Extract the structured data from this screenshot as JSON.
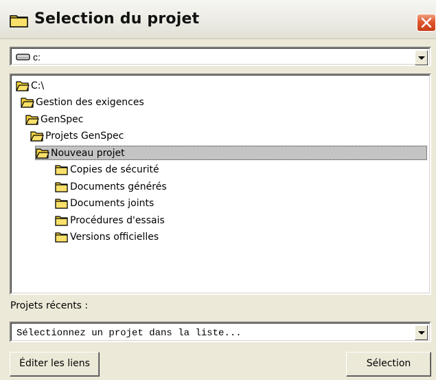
{
  "window": {
    "title": "Selection du projet",
    "title_icon": "folder-icon",
    "close_icon": "close-icon"
  },
  "drive": {
    "icon": "drive-icon",
    "selected": "c:"
  },
  "tree": {
    "items": [
      {
        "label": "C:\\",
        "depth": 0,
        "icon": "open-folder-icon",
        "selected": false
      },
      {
        "label": "Gestion des exigences",
        "depth": 1,
        "icon": "open-folder-icon",
        "selected": false
      },
      {
        "label": "GenSpec",
        "depth": 2,
        "icon": "open-folder-icon",
        "selected": false
      },
      {
        "label": "Projets GenSpec",
        "depth": 3,
        "icon": "open-folder-icon",
        "selected": false
      },
      {
        "label": "Nouveau projet",
        "depth": 4,
        "icon": "open-folder-icon",
        "selected": true
      },
      {
        "label": "Copies de sécurité",
        "depth": 5,
        "icon": "folder-icon",
        "selected": false
      },
      {
        "label": "Documents générés",
        "depth": 5,
        "icon": "folder-icon",
        "selected": false
      },
      {
        "label": "Documents joints",
        "depth": 5,
        "icon": "folder-icon",
        "selected": false
      },
      {
        "label": "Procédures d'essais",
        "depth": 5,
        "icon": "folder-icon",
        "selected": false
      },
      {
        "label": "Versions officielles",
        "depth": 5,
        "icon": "folder-icon",
        "selected": false
      }
    ]
  },
  "recent": {
    "label": "Projets récents :",
    "value": "Sélectionnez un projet dans la liste..."
  },
  "buttons": {
    "edit_links": "Éditer les liens",
    "select": "Sélection"
  },
  "colors": {
    "dialog_bg": "#ECE9D8",
    "selection_bg": "#C4C4C4",
    "folder_yellow": "#F5D13C",
    "close_red": "#E0582F"
  }
}
